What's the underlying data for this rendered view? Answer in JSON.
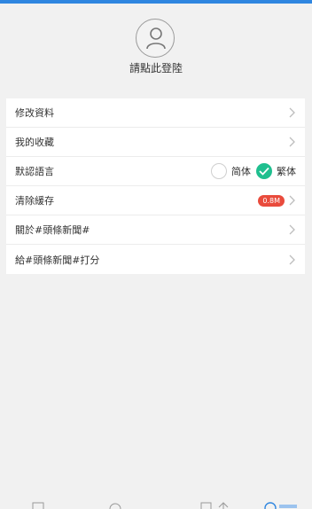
{
  "header": {
    "login_prompt": "請點此登陸",
    "avatar_icon": "user-icon"
  },
  "settings": {
    "items": [
      {
        "label": "修改資料"
      },
      {
        "label": "我的收藏"
      },
      {
        "label": "默認語言"
      },
      {
        "label": "清除緩存",
        "badge": "0.8M"
      },
      {
        "label": "關於#頭條新聞#"
      },
      {
        "label": "給#頭條新聞#打分"
      }
    ],
    "language": {
      "options": [
        "简体",
        "繁体"
      ],
      "selected": "繁体"
    }
  },
  "colors": {
    "accent": "#2f86e0",
    "selected_check": "#1fbf8f",
    "badge": "#e94b3c"
  }
}
